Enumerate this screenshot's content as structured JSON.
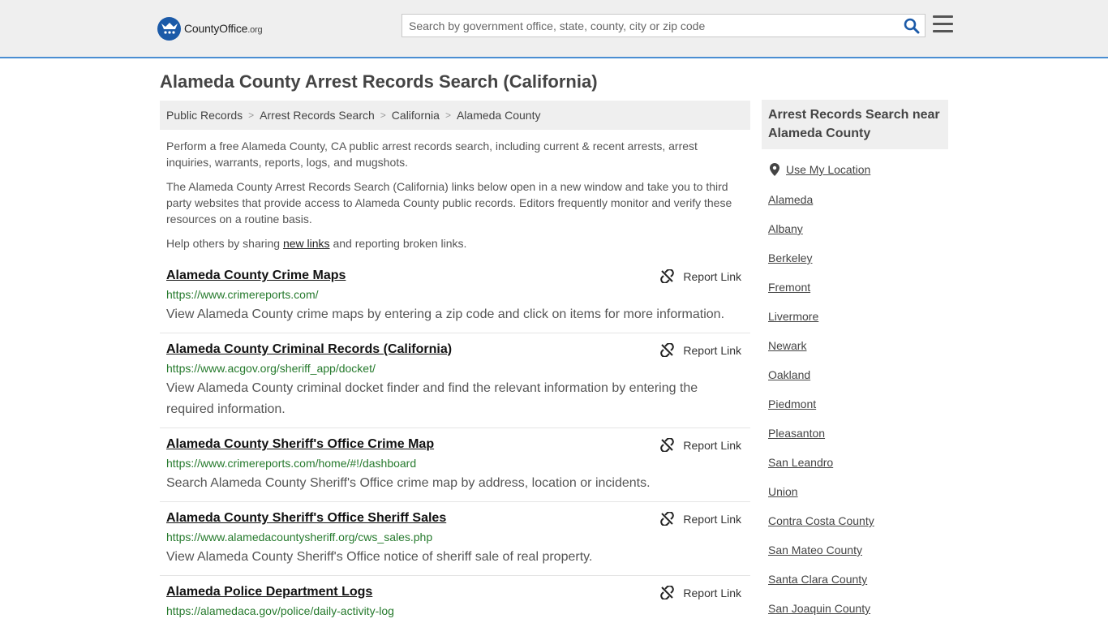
{
  "header": {
    "logo_text": "CountyOffice",
    "logo_suffix": ".org",
    "search_placeholder": "Search by government office, state, county, city or zip code"
  },
  "page_title": "Alameda County Arrest Records Search (California)",
  "breadcrumb": [
    "Public Records",
    "Arrest Records Search",
    "California",
    "Alameda County"
  ],
  "intro": {
    "p1": "Perform a free Alameda County, CA public arrest records search, including current & recent arrests, arrest inquiries, warrants, reports, logs, and mugshots.",
    "p2": "The Alameda County Arrest Records Search (California) links below open in a new window and take you to third party websites that provide access to Alameda County public records. Editors frequently monitor and verify these resources on a routine basis.",
    "p3_before": "Help others by sharing ",
    "p3_link": "new links",
    "p3_after": " and reporting broken links."
  },
  "report_label": "Report Link",
  "results": [
    {
      "title": "Alameda County Crime Maps",
      "url": "https://www.crimereports.com/",
      "desc": "View Alameda County crime maps by entering a zip code and click on items for more information."
    },
    {
      "title": "Alameda County Criminal Records (California)",
      "url": "https://www.acgov.org/sheriff_app/docket/",
      "desc": "View Alameda County criminal docket finder and find the relevant information by entering the required information."
    },
    {
      "title": "Alameda County Sheriff's Office Crime Map",
      "url": "https://www.crimereports.com/home/#!/dashboard",
      "desc": "Search Alameda County Sheriff's Office crime map by address, location or incidents."
    },
    {
      "title": "Alameda County Sheriff's Office Sheriff Sales",
      "url": "https://www.alamedacountysheriff.org/cws_sales.php",
      "desc": "View Alameda County Sheriff's Office notice of sheriff sale of real property."
    },
    {
      "title": "Alameda Police Department Logs",
      "url": "https://alamedaca.gov/police/daily-activity-log",
      "desc": ""
    }
  ],
  "sidebar": {
    "heading": "Arrest Records Search near Alameda County",
    "use_location": "Use My Location",
    "links": [
      "Alameda",
      "Albany",
      "Berkeley",
      "Fremont",
      "Livermore",
      "Newark",
      "Oakland",
      "Piedmont",
      "Pleasanton",
      "San Leandro",
      "Union",
      "Contra Costa County",
      "San Mateo County",
      "Santa Clara County",
      "San Joaquin County"
    ]
  }
}
